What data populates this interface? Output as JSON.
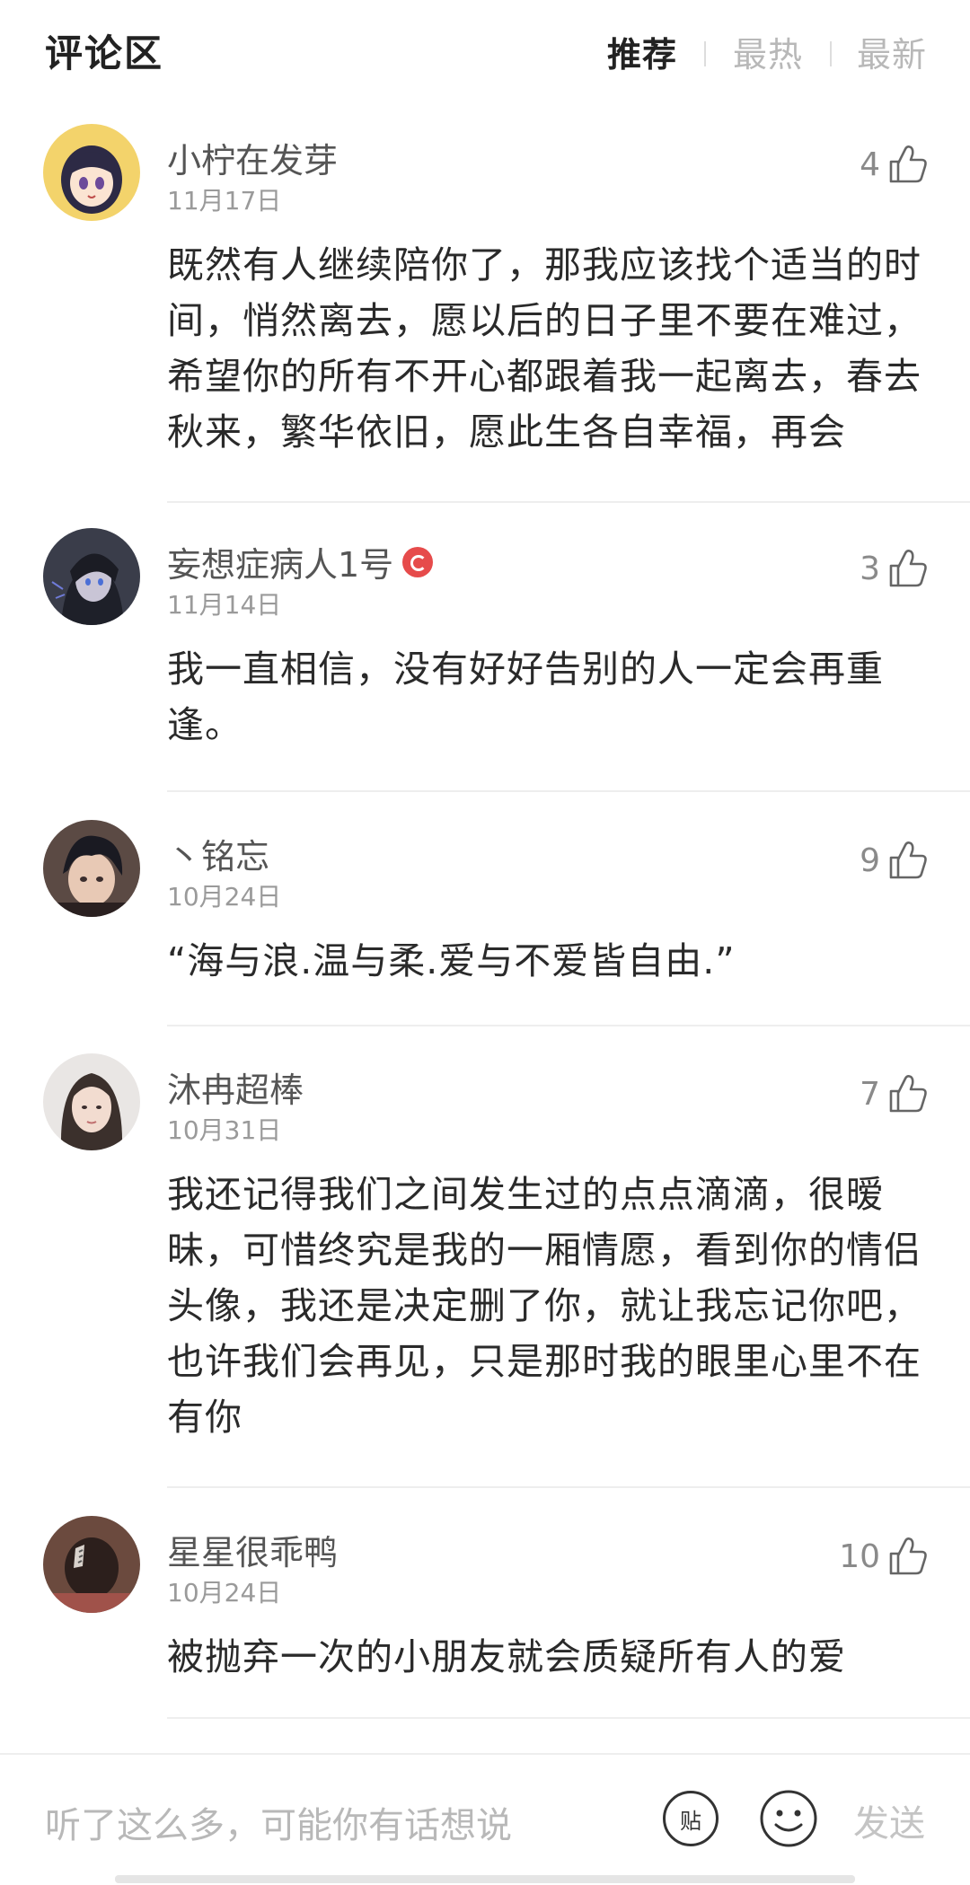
{
  "header": {
    "title": "评论区",
    "tabs": [
      {
        "label": "推荐",
        "active": true
      },
      {
        "label": "最热",
        "active": false
      },
      {
        "label": "最新",
        "active": false
      }
    ]
  },
  "comments": [
    {
      "username": "小柠在发芽",
      "date": "11月17日",
      "likes": "4",
      "text": "既然有人继续陪你了，那我应该找个适当的时间，悄然离去，愿以后的日子里不要在难过，希望你的所有不开心都跟着我一起离去，春去秋来，繁华依旧，愿此生各自幸福，再会",
      "avatar_icon": "anime-girl-avatar"
    },
    {
      "username": "妄想症病人1号",
      "date": "11月14日",
      "likes": "3",
      "text": "我一直相信，没有好好告别的人一定会再重逢。",
      "avatar_icon": "anime-dark-avatar",
      "badge_icon": "music-badge-icon"
    },
    {
      "username": "丶铭忘",
      "date": "10月24日",
      "likes": "9",
      "text": "“海与浪.温与柔.爱与不爱皆自由.”",
      "avatar_icon": "anime-boy-avatar"
    },
    {
      "username": "沐冉超棒",
      "date": "10月31日",
      "likes": "7",
      "text": "我还记得我们之间发生过的点点滴滴，很暧昧，可惜终究是我的一厢情愿，看到你的情侣头像，我还是决定删了你，就让我忘记你吧，也许我们会再见，只是那时我的眼里心里不在有你",
      "avatar_icon": "girl-photo-avatar"
    },
    {
      "username": "星星很乖鸭",
      "date": "10月24日",
      "likes": "10",
      "text": "被抛弃一次的小朋友就会质疑所有人的爱",
      "avatar_icon": "photo-avatar"
    }
  ],
  "footer": {
    "placeholder": "听了这么多，可能你有话想说",
    "sticker_label": "贴",
    "send_label": "发送"
  },
  "colors": {
    "badge": "#e64b4b",
    "muted": "#b8b8b8",
    "text": "#2a2a2a"
  }
}
